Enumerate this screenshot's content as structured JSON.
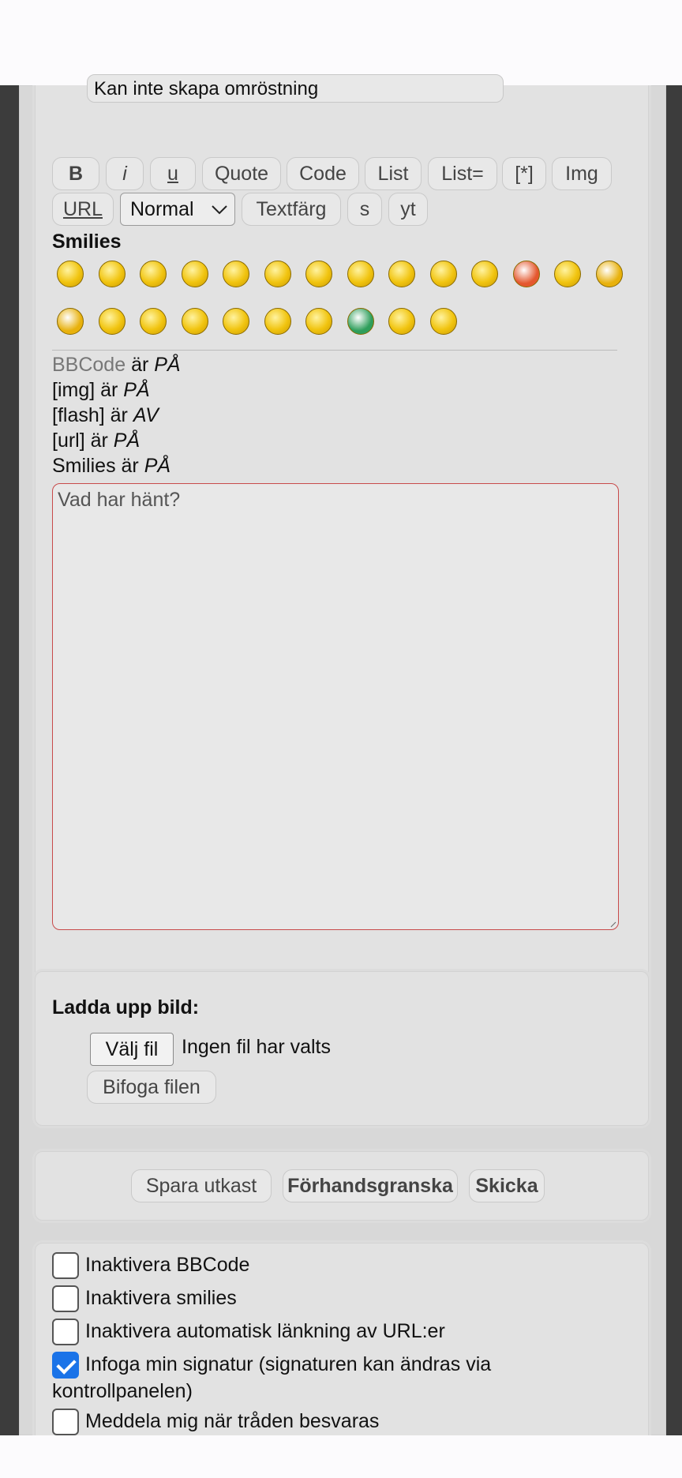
{
  "subject": {
    "value": "Kan inte skapa omröstning"
  },
  "toolbar": {
    "bold": "B",
    "italic": "i",
    "underline": "u",
    "quote": "Quote",
    "code": "Code",
    "list": "List",
    "list_ordered": "List=",
    "list_item": "[*]",
    "img": "Img",
    "url": "URL",
    "font_size": "Normal",
    "text_color": "Textfärg",
    "strike": "s",
    "yt": "yt"
  },
  "smilies": {
    "title": "Smilies",
    "icons": [
      "grin-icon",
      "smile-icon",
      "wink-icon",
      "sad-icon",
      "surprised-icon",
      "eek-icon",
      "confused-icon",
      "cool-icon",
      "laugh-icon",
      "mad-icon",
      "razz-icon",
      "redface-icon",
      "cry-icon",
      "evil-icon",
      "twisted-icon",
      "rolleyes-icon",
      "exclaim-icon",
      "question-icon",
      "idea-icon",
      "arrow-icon",
      "neutral-icon",
      "mrgreen-icon",
      "geek-icon",
      "ugeek-icon"
    ]
  },
  "status": {
    "bbcode_link": "BBCode",
    "bbcode_text": " är ",
    "bbcode_value": "PÅ",
    "img_text": "[img] är ",
    "img_value": "PÅ",
    "flash_text": "[flash] är ",
    "flash_value": "AV",
    "url_text": "[url] är ",
    "url_value": "PÅ",
    "smilies_text": "Smilies är ",
    "smilies_value": "PÅ"
  },
  "message": {
    "placeholder": "Vad har hänt?"
  },
  "upload": {
    "title": "Ladda upp bild:",
    "choose_file": "Välj fil",
    "no_file": "Ingen fil har valts",
    "attach": "Bifoga filen"
  },
  "actions": {
    "save_draft": "Spara utkast",
    "preview": "Förhandsgranska",
    "submit": "Skicka"
  },
  "options": [
    {
      "label": "Inaktivera BBCode",
      "checked": false
    },
    {
      "label": "Inaktivera smilies",
      "checked": false
    },
    {
      "label": "Inaktivera automatisk länkning av URL:er",
      "checked": false
    },
    {
      "label": "Infoga min signatur (signaturen kan ändras via",
      "label_cont": "kontrollpanelen)",
      "checked": true
    },
    {
      "label": "Meddela mig när tråden besvaras",
      "checked": false
    }
  ]
}
